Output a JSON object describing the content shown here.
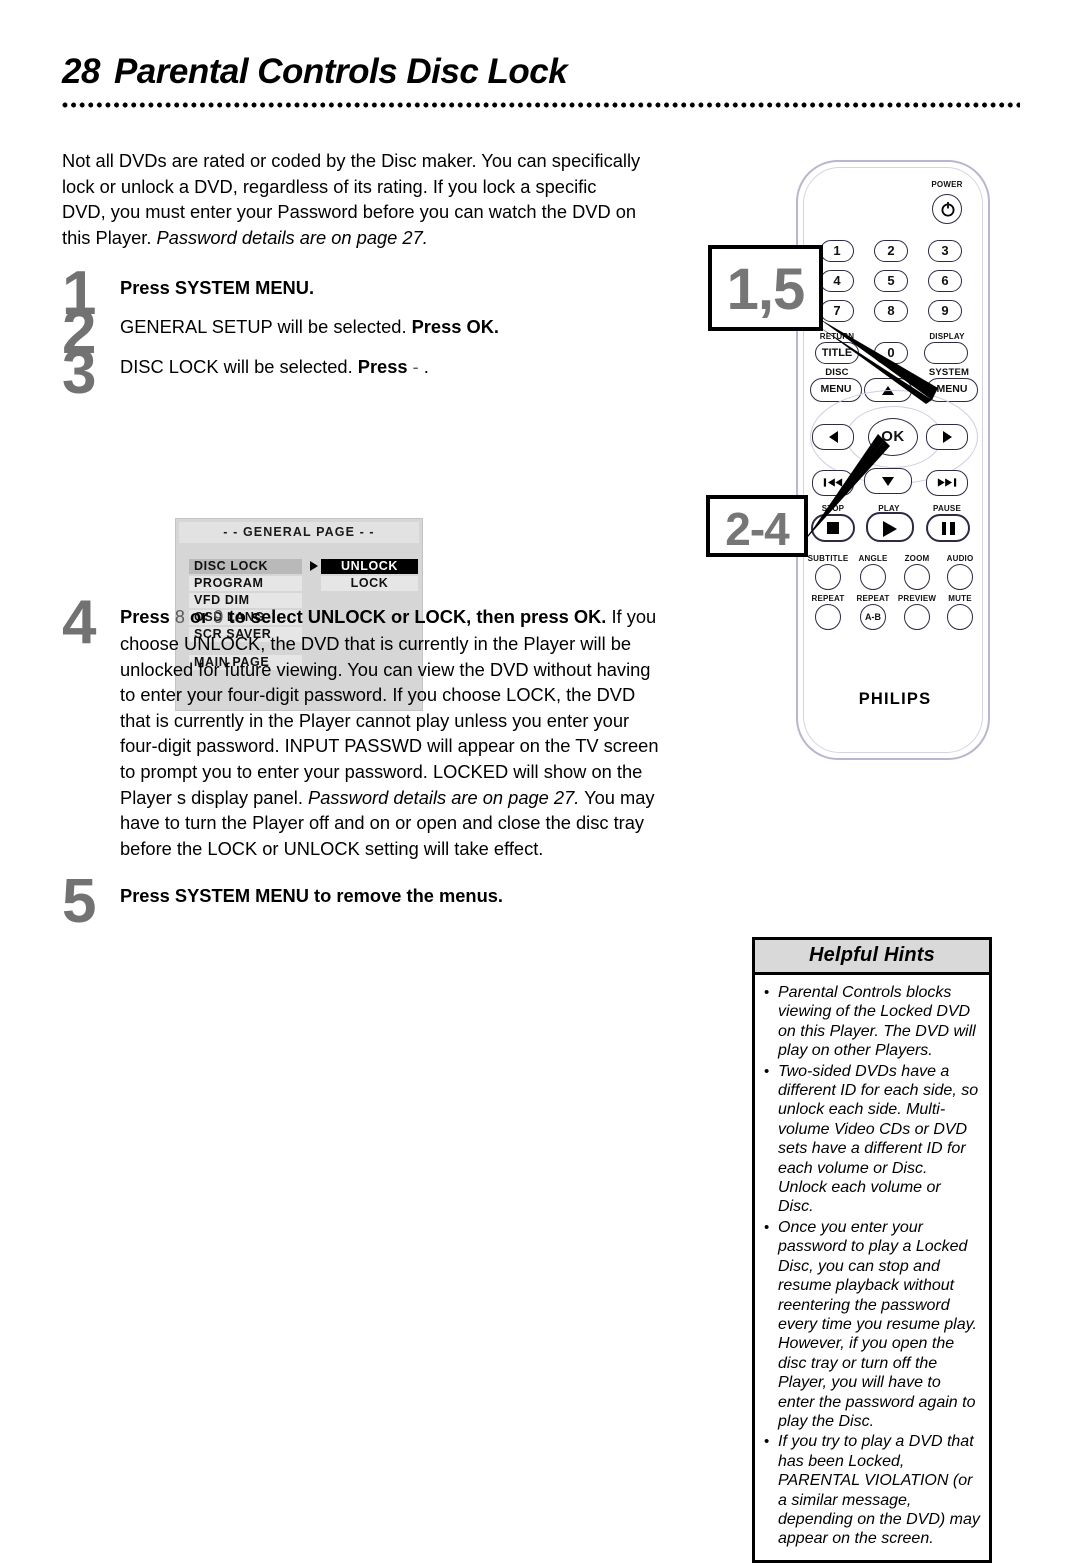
{
  "page": {
    "number": "28",
    "title": "Parental Controls Disc Lock"
  },
  "intro": {
    "line1": "Not all DVDs are rated or coded by the Disc maker. You can specifically lock or unlock a DVD, regardless of its rating. If you lock a specific DVD, you must enter your Password before you can watch the DVD on this Player. ",
    "italic_note": "Password details are on page 27."
  },
  "steps": [
    {
      "num": "1",
      "bold": "Press SYSTEM MENU.",
      "rest": ""
    },
    {
      "num": "2",
      "plain": "GENERAL SETUP will be selected. ",
      "bold": "Press OK."
    },
    {
      "num": "3",
      "plain": "DISC LOCK will be selected. ",
      "bold": "Press",
      "symbol": "-",
      "tail": "."
    },
    {
      "num": "4",
      "heading_a": "Press",
      "sym1": "8",
      "heading_b": "or",
      "sym2": "9",
      "heading_c": "to select UNLOCK or LOCK, then press OK.",
      "para1": "If you choose UNLOCK, the DVD that is currently in the Player will be unlocked for future viewing. You can view the DVD without having to enter your four-digit password.",
      "para2_a": "If you choose LOCK, the DVD that is currently in the Player cannot play unless you enter your four-digit password. INPUT PASSWD will appear on the TV screen to prompt you to enter your password. LOCKED will show on the Player s display panel. ",
      "para2_italic": "Password details are on page 27.",
      "para3": "You may have to turn the Player off and on or open and close the disc tray before the LOCK or UNLOCK setting will take effect."
    },
    {
      "num": "5",
      "bold": "Press SYSTEM MENU to remove the menus."
    }
  ],
  "osd": {
    "title": "- -  GENERAL PAGE  - -",
    "left_items": [
      {
        "label": "DISC LOCK",
        "selected": true,
        "arrow": true
      },
      {
        "label": "PROGRAM",
        "selected": false,
        "arrow": false
      },
      {
        "label": "VFD DIM",
        "selected": false,
        "arrow": false
      },
      {
        "label": "OSD LANG",
        "selected": false,
        "arrow": false
      },
      {
        "label": "SCR SAVER",
        "selected": false,
        "arrow": false
      }
    ],
    "main_page": "MAIN PAGE",
    "options": [
      {
        "label": "UNLOCK",
        "inverted": true
      },
      {
        "label": "LOCK",
        "inverted": false
      }
    ]
  },
  "remote": {
    "brand": "PHILIPS",
    "callouts": [
      {
        "id": "callout-15",
        "text": "1,5"
      },
      {
        "id": "callout-24",
        "text": "2-4"
      }
    ],
    "power_label": "POWER",
    "keypad": [
      {
        "label": "1"
      },
      {
        "label": "2"
      },
      {
        "label": "3"
      },
      {
        "label": "4"
      },
      {
        "label": "5"
      },
      {
        "label": "6"
      },
      {
        "label": "7"
      },
      {
        "label": "8"
      },
      {
        "label": "9"
      }
    ],
    "return_label": "RETURN",
    "title_key": "TITLE",
    "zero_key": "0",
    "display_label": "DISPLAY",
    "disc_label": "DISC",
    "disc_menu_key": "MENU",
    "system_label": "SYSTEM",
    "system_menu_key": "MENU",
    "ok_key": "OK",
    "transport": [
      {
        "label": "STOP",
        "glyph": "stop-icon"
      },
      {
        "label": "PLAY",
        "glyph": "play-icon"
      },
      {
        "label": "PAUSE",
        "glyph": "pause-icon"
      }
    ],
    "function_row_1": [
      "SUBTITLE",
      "ANGLE",
      "ZOOM",
      "AUDIO"
    ],
    "function_row_2": [
      "REPEAT",
      "REPEAT",
      "PREVIEW",
      "MUTE"
    ],
    "repeat_ab_key": "A-B"
  },
  "hints": {
    "header": "Helpful Hints",
    "items": [
      "Parental Controls blocks viewing of the Locked DVD on this Player. The DVD will play on other Players.",
      "Two-sided DVDs have a different ID for each side, so unlock each side. Multi-volume Video CDs or DVD sets have a different ID for each volume or Disc. Unlock each volume or Disc.",
      "Once you enter your password to play a Locked Disc, you can stop and resume playback without reentering the password every time you resume play. However, if you open the disc tray or turn off the Player, you will have to enter the password again to play the Disc.",
      "If you try to play a DVD that has been Locked, PARENTAL VIOLATION (or a similar message, depending on the DVD) may appear on the screen."
    ]
  }
}
